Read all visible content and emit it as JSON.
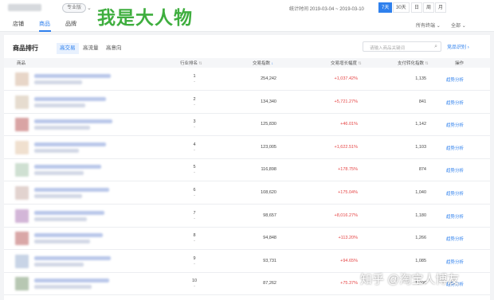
{
  "header": {
    "pro_badge": "专业版",
    "watermark": "我是大人物",
    "date_label": "统计时间 2019-03-04 ~ 2019-03-10",
    "periods": [
      "7天",
      "30天",
      "日",
      "周",
      "月"
    ]
  },
  "nav": {
    "tabs": [
      "店铺",
      "商品",
      "品牌"
    ],
    "active_tab": "商品",
    "terminal": "所有终端",
    "scope": "全部"
  },
  "panel": {
    "title": "商品排行",
    "sub_tabs": [
      "高交易",
      "高流量",
      "高意向"
    ],
    "search_placeholder": "请输入商品关键词",
    "compare_link": "竞品识别"
  },
  "table": {
    "headers": [
      "商品",
      "行业排名",
      "交易指数",
      "交易增长幅度",
      "支付转化指数",
      "操作"
    ],
    "rows": [
      {
        "rank": "1",
        "change": "-",
        "trade_index": "254,242",
        "growth": "+1,037.42%",
        "conversion": "1,135",
        "action": "趋势分析"
      },
      {
        "rank": "2",
        "change": "-",
        "trade_index": "134,340",
        "growth": "+5,721.27%",
        "conversion": "841",
        "action": "趋势分析"
      },
      {
        "rank": "3",
        "change": "-",
        "trade_index": "125,830",
        "growth": "+46.01%",
        "conversion": "1,142",
        "action": "趋势分析"
      },
      {
        "rank": "4",
        "change": "-",
        "trade_index": "123,005",
        "growth": "+1,622.51%",
        "conversion": "1,103",
        "action": "趋势分析"
      },
      {
        "rank": "5",
        "change": "-",
        "trade_index": "116,898",
        "growth": "+178.75%",
        "conversion": "874",
        "action": "趋势分析"
      },
      {
        "rank": "6",
        "change": "-",
        "trade_index": "108,620",
        "growth": "+175.04%",
        "conversion": "1,040",
        "action": "趋势分析"
      },
      {
        "rank": "7",
        "change": "-",
        "trade_index": "98,657",
        "growth": "+8,016.27%",
        "conversion": "1,180",
        "action": "趋势分析"
      },
      {
        "rank": "8",
        "change": "-",
        "trade_index": "94,848",
        "growth": "+113.20%",
        "conversion": "1,266",
        "action": "趋势分析"
      },
      {
        "rank": "9",
        "change": "-",
        "trade_index": "93,731",
        "growth": "+94.65%",
        "conversion": "1,085",
        "action": "趋势分析"
      },
      {
        "rank": "10",
        "change": "-",
        "trade_index": "87,262",
        "growth": "+75.37%",
        "conversion": "1,100",
        "action": "趋势分析"
      }
    ]
  },
  "footer_watermark": "知乎 @淘宝人博友",
  "colors": {
    "accent": "#2f80ed",
    "growth": "#e54545",
    "watermark": "#3fae3f"
  }
}
